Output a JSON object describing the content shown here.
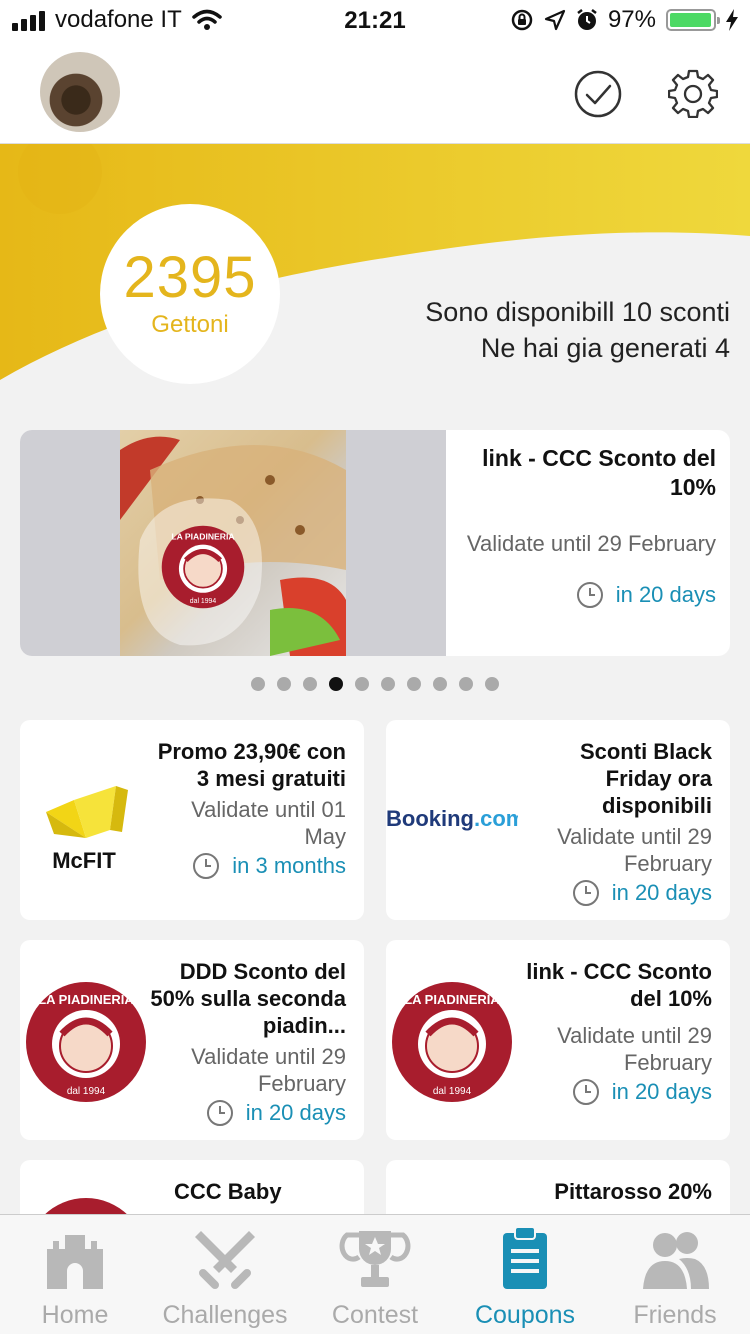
{
  "status_bar": {
    "carrier": "vodafone IT",
    "time": "21:21",
    "battery": "97%",
    "battery_level": 0.97
  },
  "header": {
    "avatar": "profile-photo",
    "icons": [
      "checkmark-circle-icon",
      "gear-icon"
    ]
  },
  "hero": {
    "coins": "2395",
    "coins_label": "Gettoni",
    "line1": "Sono disponibill 10 sconti",
    "line2": "Ne hai gia generati 4",
    "accent_color": "#e4b51d"
  },
  "featured": {
    "title": "link - CCC Sconto del 10%",
    "validity": "Validate until 29 February",
    "remaining": "in 20 days",
    "logo": "la-piadineria-logo"
  },
  "pagination": {
    "count": 10,
    "active_index": 3
  },
  "coupons": [
    {
      "title": "Promo 23,90€ con 3 mesi gratuiti",
      "validity": "Validate until 01 May",
      "remaining": "in 3 months",
      "logo": "mcfit-logo",
      "logo_text": "McFIT"
    },
    {
      "title": "Sconti Black Friday ora disponibili",
      "validity": "Validate until 29 February",
      "remaining": "in 20 days",
      "logo": "booking-logo",
      "logo_text": "Booking.com"
    },
    {
      "title": "DDD Sconto del 50% sulla seconda piadin...",
      "validity": "Validate until 29 February",
      "remaining": "in 20 days",
      "logo": "la-piadineria-logo"
    },
    {
      "title": "link - CCC Sconto del 10%",
      "validity": "Validate until 29 February",
      "remaining": "in 20 days",
      "logo": "la-piadineria-logo"
    },
    {
      "title": "CCC Baby",
      "logo": "la-piadineria-logo"
    },
    {
      "title": "Pittarosso 20%"
    }
  ],
  "nav": {
    "items": [
      {
        "label": "Home",
        "icon": "castle-icon"
      },
      {
        "label": "Challenges",
        "icon": "crossed-swords-icon"
      },
      {
        "label": "Contest",
        "icon": "trophy-icon"
      },
      {
        "label": "Coupons",
        "icon": "clipboard-icon"
      },
      {
        "label": "Friends",
        "icon": "people-icon"
      }
    ],
    "active": "Coupons",
    "active_color": "#1a8fb5",
    "inactive_color": "#aaaaaa"
  }
}
